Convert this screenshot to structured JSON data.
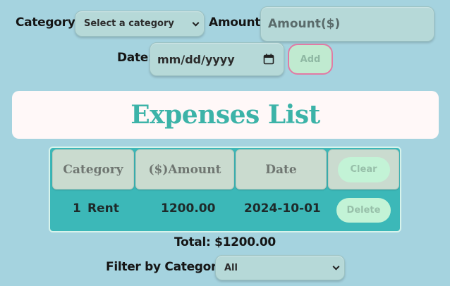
{
  "form": {
    "category_label": "Category:",
    "category_select_value": "Select a category",
    "amount_label": "Amount:",
    "amount_placeholder": "Amount($)",
    "date_label": "Date:",
    "date_placeholder": "mm/dd/yyyy",
    "add_button": "Add"
  },
  "banner": {
    "title": "Expenses List"
  },
  "table": {
    "headers": [
      "Category",
      "($)Amount",
      "Date"
    ],
    "clear_button": "Clear",
    "rows": [
      {
        "index": "1",
        "category": "Rent",
        "amount": "1200.00",
        "date": "2024-10-01",
        "delete_label": "Delete"
      }
    ]
  },
  "total": {
    "text": "Total: $1200.00"
  },
  "filter": {
    "label": "Filter by Category:",
    "value": "All"
  },
  "colors": {
    "background": "#a5d3df",
    "accent_teal": "#3cb3a8",
    "button_green": "#c3f3d6",
    "add_border_pink": "#e27aa4"
  }
}
